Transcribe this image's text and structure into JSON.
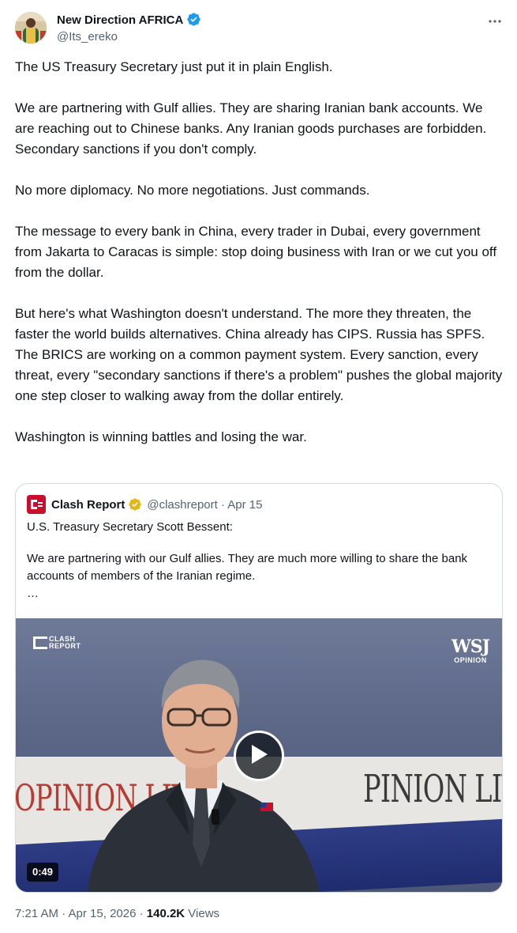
{
  "author": {
    "name": "New Direction AFRICA",
    "handle": "@Its_ereko",
    "verified_color": "#1d9bf0"
  },
  "tweet": {
    "paragraphs": [
      "The US Treasury Secretary just put it in plain English.",
      "We are partnering with Gulf allies. They are sharing Iranian bank accounts. We are reaching out to Chinese banks. Any Iranian goods purchases are forbidden. Secondary sanctions if you don't comply.",
      "No more diplomacy. No more negotiations. Just commands.",
      "The message to every bank in China, every trader in Dubai, every government from Jakarta to Caracas is simple: stop doing business with Iran or we cut you off from the dollar.",
      "But here's what Washington doesn't understand. The more they threaten, the faster the world builds alternatives. China already has CIPS. Russia has SPFS. The BRICS are working on a common payment system. Every sanction, every threat, every \"secondary sanctions if there's a problem\" pushes the global majority one step closer to walking away from the dollar entirely.",
      "Washington is winning battles and losing the war."
    ]
  },
  "quote": {
    "name": "Clash Report",
    "handle_date": "@clashreport · Apr 15",
    "badge_color": "#e2b719",
    "paragraphs": [
      "U.S. Treasury Secretary Scott Bessent:",
      "We are partnering with our Gulf allies. They are much more willing to share the bank accounts of members of the Iranian regime."
    ],
    "ellipsis": "…",
    "video": {
      "duration": "0:49",
      "logo_clash_top": "CLASH",
      "logo_clash_bottom": "REPORT",
      "logo_wsj": "WSJ",
      "logo_wsj_sub": "OPINION",
      "banner_left": "OPINION LIV",
      "banner_right": "PINION LIVE"
    }
  },
  "footer": {
    "time_date": "7:21 AM · Apr 15, 2026 · ",
    "views_count": "140.2K",
    "views_label": " Views"
  },
  "icons": {
    "more": "more-horizontal-icon",
    "verified": "verified-badge-icon",
    "play": "play-icon"
  }
}
